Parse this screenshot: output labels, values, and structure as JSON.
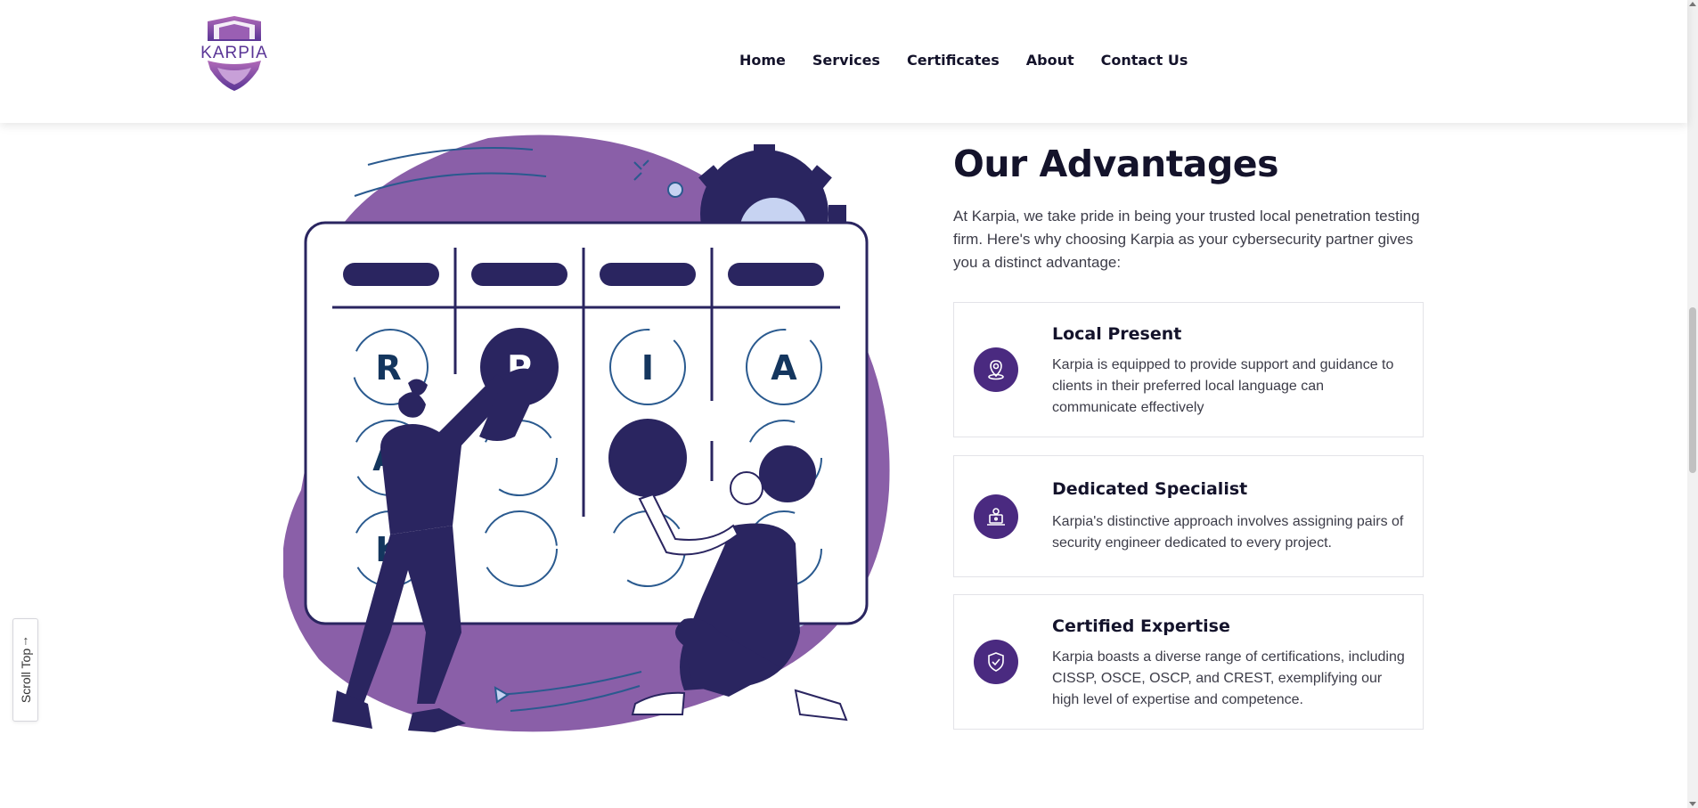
{
  "brand": {
    "logo_text": "KARPIA",
    "colors": {
      "primary": "#4a2a80",
      "accent_purple": "#8a5fa8",
      "navy": "#2a2560"
    }
  },
  "nav": {
    "items": [
      "Home",
      "Services",
      "Certificates",
      "About",
      "Contact Us"
    ]
  },
  "advantages": {
    "title": "Our Advantages",
    "intro": "At Karpia, we take pride in being your trusted local penetration testing firm. Here's why choosing Karpia as your cybersecurity partner gives you a distinct advantage:",
    "cards": [
      {
        "title": "Local Present",
        "text": "Karpia is equipped to provide support and guidance to clients in their preferred local language can communicate effectively",
        "icon": "location-pin-icon"
      },
      {
        "title": "Dedicated Specialist",
        "text": "Karpia's distinctive approach involves assigning pairs of security engineer dedicated to every project.",
        "icon": "specialist-computer-icon"
      },
      {
        "title": "Certified Expertise",
        "text": "Karpia boasts a diverse range of certifications, including CISSP, OSCE, OSCP, and CREST, exemplifying our high level of expertise and competence.",
        "icon": "shield-check-icon"
      }
    ]
  },
  "illustration": {
    "letters": [
      "R",
      "P",
      "I",
      "A",
      "A",
      "K"
    ]
  },
  "scroll_top": {
    "label": "Scroll Top",
    "arrow": "↑"
  }
}
